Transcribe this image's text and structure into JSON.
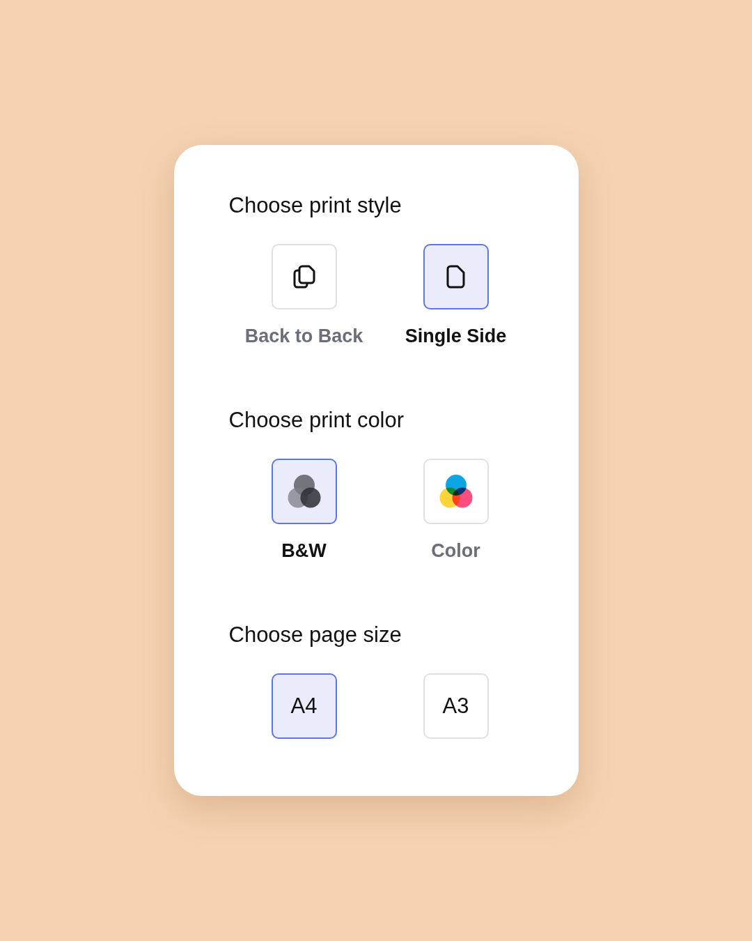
{
  "sections": [
    {
      "title": "Choose print style",
      "options": [
        {
          "kind": "stack",
          "label": "Back to Back",
          "selected": false
        },
        {
          "kind": "page",
          "label": "Single Side",
          "selected": true
        }
      ]
    },
    {
      "title": "Choose print color",
      "options": [
        {
          "kind": "mono",
          "label": "B&W",
          "selected": true
        },
        {
          "kind": "tricolor",
          "label": "Color",
          "selected": false
        }
      ]
    },
    {
      "title": "Choose page size",
      "options": [
        {
          "kind": "text",
          "label": "A4",
          "selected": true
        },
        {
          "kind": "text",
          "label": "A3",
          "selected": false
        }
      ]
    }
  ]
}
